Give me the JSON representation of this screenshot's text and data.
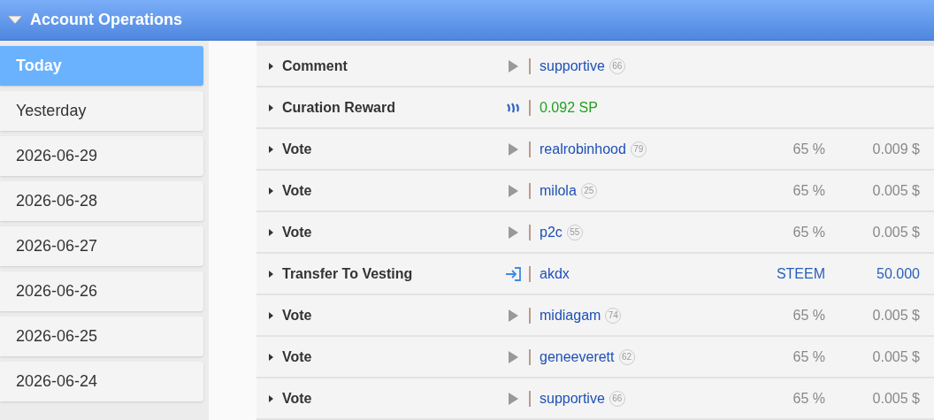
{
  "panel": {
    "title": "Account Operations",
    "expanded": true
  },
  "days": [
    {
      "label": "Today",
      "selected": true
    },
    {
      "label": "Yesterday",
      "selected": false
    },
    {
      "label": "2026-06-29",
      "selected": false
    },
    {
      "label": "2026-06-28",
      "selected": false
    },
    {
      "label": "2026-06-27",
      "selected": false
    },
    {
      "label": "2026-06-26",
      "selected": false
    },
    {
      "label": "2026-06-25",
      "selected": false
    },
    {
      "label": "2026-06-24",
      "selected": false
    }
  ],
  "operations": [
    {
      "kind": "post",
      "type": "Comment",
      "target": "supportive",
      "reputation": "66"
    },
    {
      "kind": "reward",
      "type": "Curation Reward",
      "amount": "0.092 SP"
    },
    {
      "kind": "post",
      "type": "Vote",
      "target": "realrobinhood",
      "reputation": "79",
      "weight": "65 %",
      "value": "0.009 $"
    },
    {
      "kind": "post",
      "type": "Vote",
      "target": "milola",
      "reputation": "25",
      "weight": "65 %",
      "value": "0.005 $"
    },
    {
      "kind": "post",
      "type": "Vote",
      "target": "p2c",
      "reputation": "55",
      "weight": "65 %",
      "value": "0.005 $"
    },
    {
      "kind": "transfer",
      "type": "Transfer To Vesting",
      "target": "akdx",
      "weight": "STEEM",
      "value": "50.000"
    },
    {
      "kind": "post",
      "type": "Vote",
      "target": "midiagam",
      "reputation": "74",
      "weight": "65 %",
      "value": "0.005 $"
    },
    {
      "kind": "post",
      "type": "Vote",
      "target": "geneeverett",
      "reputation": "62",
      "weight": "65 %",
      "value": "0.005 $"
    },
    {
      "kind": "post",
      "type": "Vote",
      "target": "supportive",
      "reputation": "66",
      "weight": "65 %",
      "value": "0.005 $"
    }
  ]
}
